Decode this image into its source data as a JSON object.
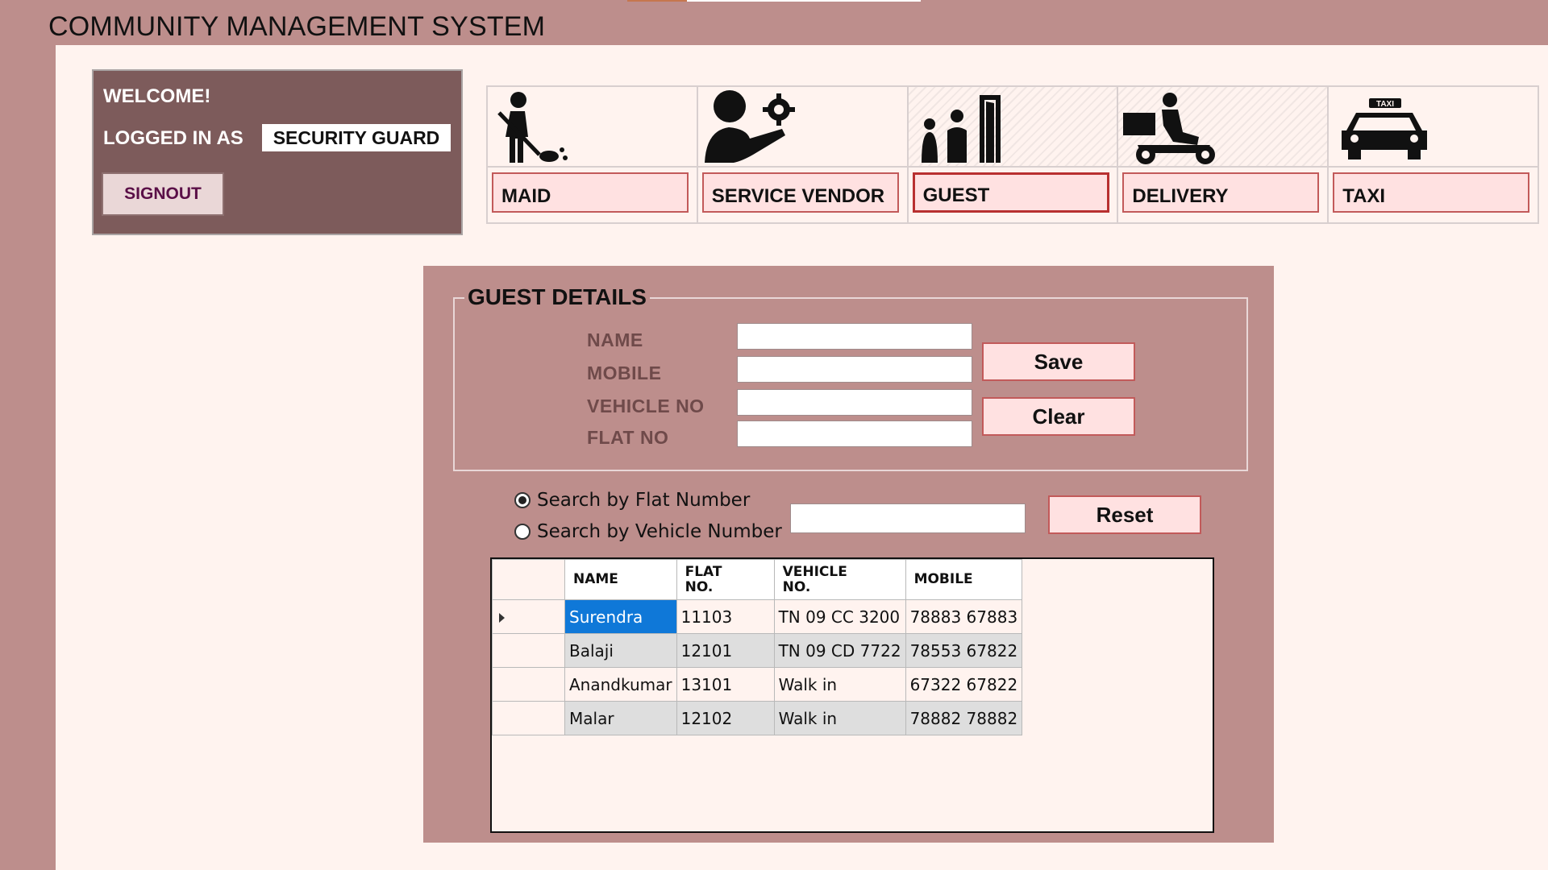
{
  "app": {
    "title": "COMMUNITY MANAGEMENT SYSTEM"
  },
  "welcome": {
    "greeting": "WELCOME!",
    "logged_in_label": "LOGGED IN AS",
    "role": "SECURITY GUARD",
    "signout_label": "SIGNOUT"
  },
  "categories": [
    {
      "label": "MAID",
      "icon": "maid-icon"
    },
    {
      "label": "SERVICE VENDOR",
      "icon": "service-vendor-icon"
    },
    {
      "label": "GUEST",
      "icon": "guest-icon"
    },
    {
      "label": "DELIVERY",
      "icon": "delivery-icon"
    },
    {
      "label": "TAXI",
      "icon": "taxi-icon"
    }
  ],
  "active_category": "GUEST",
  "guest_form": {
    "title": "GUEST DETAILS",
    "fields": {
      "name_label": "NAME",
      "mobile_label": "MOBILE",
      "vehicle_label": "VEHICLE NO",
      "flat_label": "FLAT NO",
      "name_value": "",
      "mobile_value": "",
      "vehicle_value": "",
      "flat_value": ""
    },
    "save_label": "Save",
    "clear_label": "Clear"
  },
  "search": {
    "by_flat_label": "Search by Flat Number",
    "by_vehicle_label": "Search by Vehicle Number",
    "selected": "flat",
    "value": "",
    "reset_label": "Reset"
  },
  "grid": {
    "columns": {
      "name": "NAME",
      "flat_line1": "FLAT",
      "flat_line2": "NO.",
      "vehicle_line1": "VEHICLE",
      "vehicle_line2": "NO.",
      "mobile": "MOBILE"
    },
    "rows": [
      {
        "name": "Surendra",
        "flat": "11103",
        "vehicle": "TN 09 CC 3200",
        "mobile": "78883 67883"
      },
      {
        "name": "Balaji",
        "flat": "12101",
        "vehicle": "TN 09 CD 7722",
        "mobile": "78553 67822"
      },
      {
        "name": "Anandkumar",
        "flat": "13101",
        "vehicle": "Walk in",
        "mobile": "67322 67822"
      },
      {
        "name": "Malar",
        "flat": "12102",
        "vehicle": "Walk in",
        "mobile": "78882 78882"
      }
    ]
  },
  "colors": {
    "frame": "#bd8e8c",
    "content_bg": "#fff3ef",
    "welcome_panel": "#7d5b5b",
    "button_fill": "#ffe1e1",
    "button_border": "#c25a5a",
    "selection": "#0f78d8"
  }
}
